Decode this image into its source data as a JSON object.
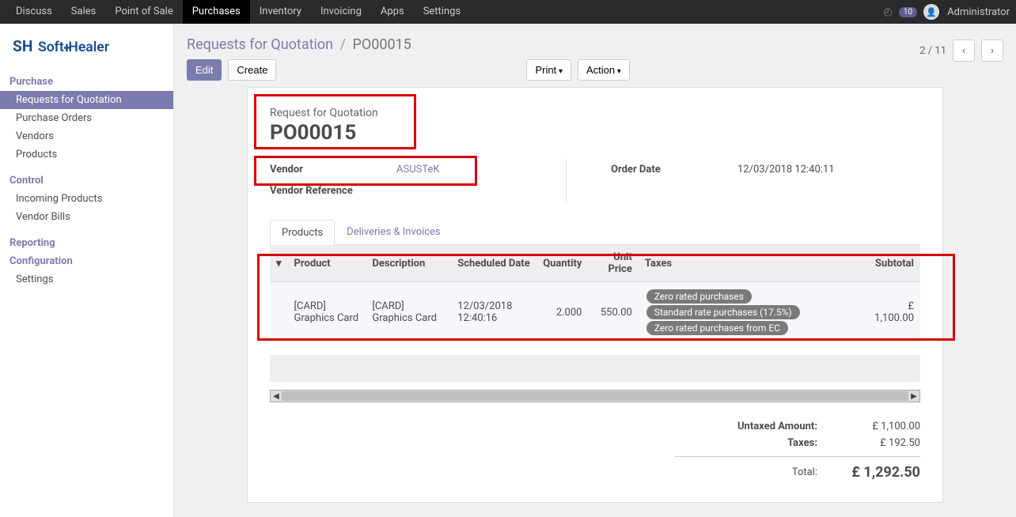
{
  "topnav": {
    "menu": [
      "Discuss",
      "Sales",
      "Point of Sale",
      "Purchases",
      "Inventory",
      "Invoicing",
      "Apps",
      "Settings"
    ],
    "active_index": 3,
    "badge": "10",
    "username": "Administrator"
  },
  "sidebar": {
    "logo_text": "SoftHealer",
    "groups": [
      {
        "title": "Purchase",
        "items": [
          "Requests for Quotation",
          "Purchase Orders",
          "Vendors",
          "Products"
        ],
        "active_index": 0
      },
      {
        "title": "Control",
        "items": [
          "Incoming Products",
          "Vendor Bills"
        ]
      },
      {
        "title": "Reporting",
        "items": []
      },
      {
        "title": "Configuration",
        "items": [
          "Settings"
        ]
      }
    ]
  },
  "header": {
    "breadcrumb_link": "Requests for Quotation",
    "breadcrumb_sep": "/",
    "breadcrumb_current": "PO00015",
    "buttons": {
      "edit": "Edit",
      "create": "Create",
      "print": "Print",
      "action": "Action"
    },
    "pager": {
      "text": "2 / 11"
    }
  },
  "doc": {
    "subtitle": "Request for Quotation",
    "title": "PO00015",
    "fields": {
      "vendor_label": "Vendor",
      "vendor_value": "ASUSTeK",
      "vendor_ref_label": "Vendor Reference",
      "vendor_ref_value": "",
      "order_date_label": "Order Date",
      "order_date_value": "12/03/2018 12:40:11"
    },
    "tabs": {
      "products": "Products",
      "deliveries": "Deliveries & Invoices"
    },
    "table": {
      "headers": {
        "product": "Product",
        "description": "Description",
        "scheduled": "Scheduled Date",
        "qty": "Quantity",
        "unit": "Unit Price",
        "taxes": "Taxes",
        "subtotal": "Subtotal"
      },
      "rows": [
        {
          "product": "[CARD] Graphics Card",
          "description": "[CARD] Graphics Card",
          "scheduled": "12/03/2018 12:40:16",
          "qty": "2.000",
          "unit": "550.00",
          "taxes": [
            "Zero rated purchases",
            "Standard rate purchases (17.5%)",
            "Zero rated purchases from EC"
          ],
          "subtotal": "£ 1,100.00"
        }
      ]
    },
    "totals": {
      "untaxed_label": "Untaxed Amount:",
      "untaxed_value": "£ 1,100.00",
      "taxes_label": "Taxes:",
      "taxes_value": "£ 192.50",
      "total_label": "Total:",
      "total_value": "£ 1,292.50"
    }
  }
}
